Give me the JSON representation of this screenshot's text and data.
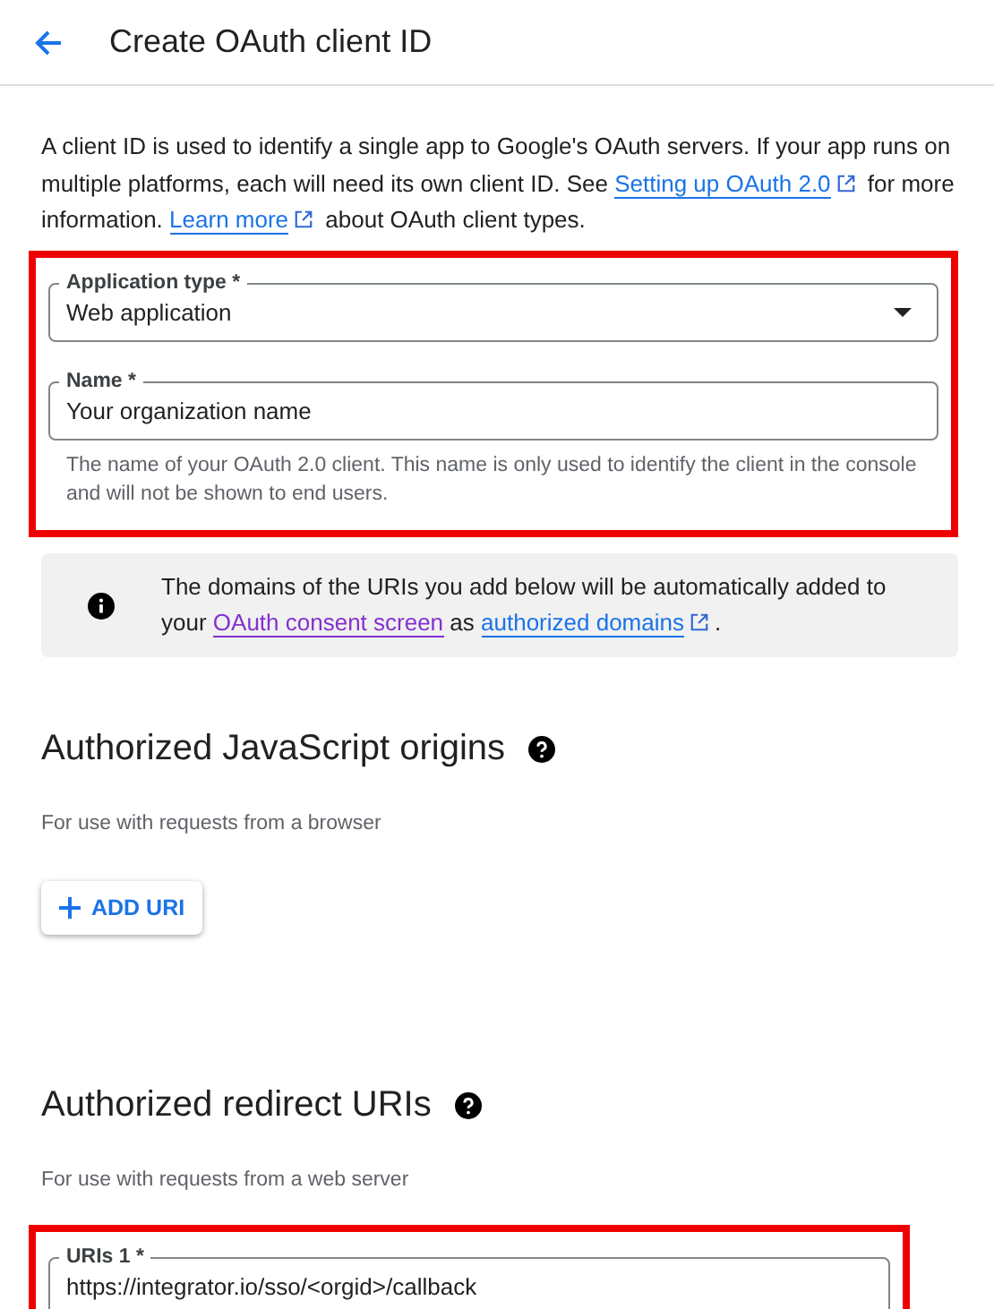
{
  "header": {
    "title": "Create OAuth client ID"
  },
  "intro": [
    {
      "kind": "text",
      "text": "A client ID is used to identify a single app to Google's OAuth servers. If your app runs on multiple platforms, each will need its own client ID. See "
    },
    {
      "kind": "link",
      "text": "Setting up OAuth 2.0",
      "external": true,
      "visited": false
    },
    {
      "kind": "text",
      "text": " for more information. "
    },
    {
      "kind": "link",
      "text": "Learn more",
      "external": true,
      "visited": false
    },
    {
      "kind": "text",
      "text": " about OAuth client types."
    }
  ],
  "form": {
    "highlighted": true,
    "fields": [
      {
        "kind": "select",
        "label": "Application type *",
        "value": "Web application"
      },
      {
        "kind": "text",
        "label": "Name *",
        "value": "Your organization name",
        "hint": "The name of your OAuth 2.0 client. This name is only used to identify the client in the console and will not be shown to end users."
      }
    ]
  },
  "notice": [
    {
      "kind": "text",
      "text": "The domains of the URIs you add below will be automatically added to your "
    },
    {
      "kind": "link",
      "text": "OAuth consent screen",
      "external": false,
      "visited": true
    },
    {
      "kind": "text",
      "text": " as "
    },
    {
      "kind": "link",
      "text": "authorized domains",
      "external": true,
      "visited": false
    },
    {
      "kind": "text",
      "text": "."
    }
  ],
  "sections": [
    {
      "title": "Authorized JavaScript origins",
      "subtitle": "For use with requests from a browser",
      "button": "ADD URI"
    },
    {
      "title": "Authorized redirect URIs",
      "subtitle": "For use with requests from a web server",
      "highlighted": true,
      "uris": [
        {
          "label": "URIs 1 *",
          "value": "https://integrator.io/sso/<orgid>/callback"
        }
      ]
    }
  ]
}
